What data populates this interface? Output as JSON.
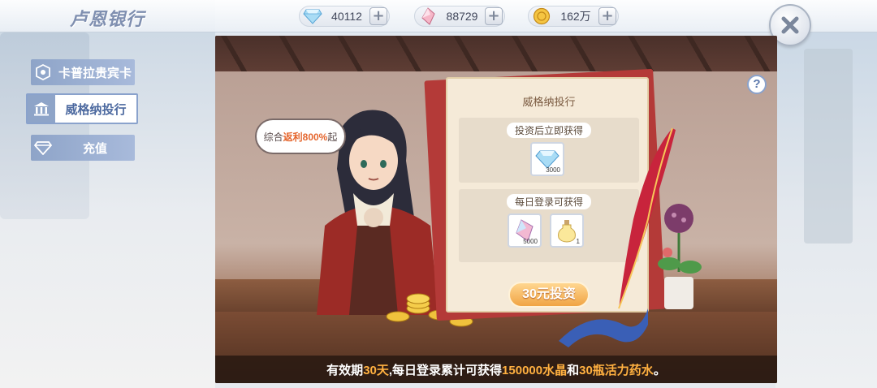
{
  "header": {
    "title": "卢恩银行",
    "currencies": [
      {
        "icon": "diamond-icon",
        "value": "40112"
      },
      {
        "icon": "crystal-icon",
        "value": "88729"
      },
      {
        "icon": "coin-icon",
        "value": "162万"
      }
    ],
    "plus_label": "+",
    "close_icon": "close-icon"
  },
  "sidebar": {
    "items": [
      {
        "label": "卡普拉贵宾卡",
        "icon": "card-icon",
        "active": false
      },
      {
        "label": "威格纳投行",
        "icon": "bank-icon",
        "active": true
      },
      {
        "label": "充值",
        "icon": "diamond-icon",
        "active": false
      }
    ]
  },
  "main": {
    "help_label": "?",
    "bubble": {
      "prefix": "综合",
      "highlight": "返利800%",
      "suffix": "起"
    },
    "card": {
      "title": "威格纳投行",
      "instant": {
        "label": "投资后立即获得",
        "rewards": [
          {
            "icon": "diamond-icon",
            "qty": "3000"
          }
        ]
      },
      "daily": {
        "label": "每日登录可获得",
        "rewards": [
          {
            "icon": "crystal-icon",
            "qty": "5000"
          },
          {
            "icon": "potion-icon",
            "qty": "1"
          }
        ]
      }
    },
    "invest_button": "30元投资",
    "footer": {
      "p1": "有效期",
      "h1": "30天",
      "p2": ",每日登录累计可获得",
      "h2": "150000水晶",
      "p3": "和",
      "h3": "30瓶活力药水",
      "p4": "。"
    }
  },
  "colors": {
    "accent": "#8ea4c8",
    "highlight": "#ffb040",
    "button": "#f0a444"
  }
}
